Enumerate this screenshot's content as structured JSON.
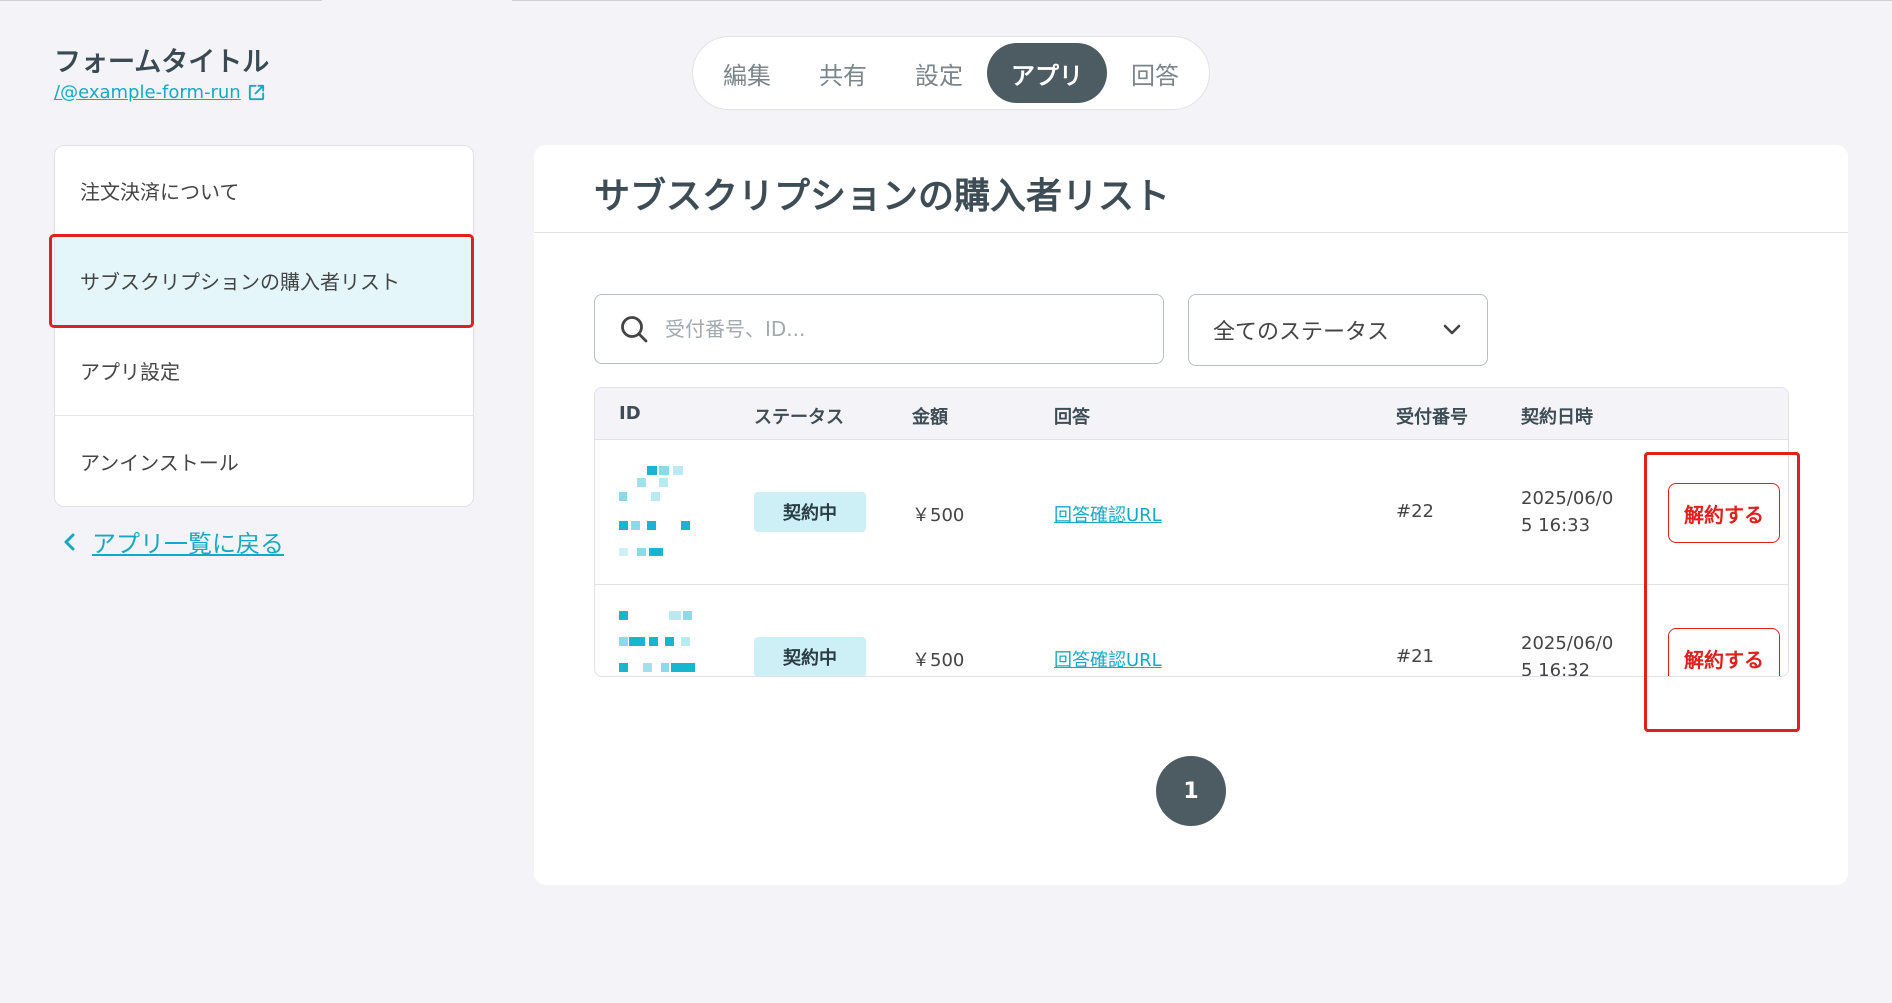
{
  "header": {
    "form_title": "フォームタイトル",
    "form_link": "/@example-form-run"
  },
  "tabs": [
    {
      "label": "編集",
      "active": false
    },
    {
      "label": "共有",
      "active": false
    },
    {
      "label": "設定",
      "active": false
    },
    {
      "label": "アプリ",
      "active": true
    },
    {
      "label": "回答",
      "active": false
    }
  ],
  "sidebar": {
    "items": [
      {
        "label": "注文決済について",
        "active": false
      },
      {
        "label": "サブスクリプションの購入者リスト",
        "active": true
      },
      {
        "label": "アプリ設定",
        "active": false
      },
      {
        "label": "アンインストール",
        "active": false
      }
    ],
    "back_label": "アプリ一覧に戻る"
  },
  "main": {
    "title": "サブスクリプションの購入者リスト",
    "search_placeholder": "受付番号、ID...",
    "status_filter": "全てのステータス",
    "table": {
      "columns": [
        "ID",
        "ステータス",
        "金額",
        "回答",
        "受付番号",
        "契約日時"
      ],
      "rows": [
        {
          "status": "契約中",
          "amount": "￥500",
          "answer": "回答確認URL",
          "receipt": "#22",
          "date_line1": "2025/06/0",
          "date_line2": "5 16:33",
          "action": "解約する"
        },
        {
          "status": "契約中",
          "amount": "￥500",
          "answer": "回答確認URL",
          "receipt": "#21",
          "date_line1": "2025/06/0",
          "date_line2": "5 16:32",
          "action": "解約する"
        }
      ]
    },
    "pagination": {
      "current": "1"
    }
  },
  "colors": {
    "accent": "#17a9c4",
    "dark": "#4d5c63",
    "danger": "#e0201b",
    "badge_bg": "#cdeff6"
  }
}
